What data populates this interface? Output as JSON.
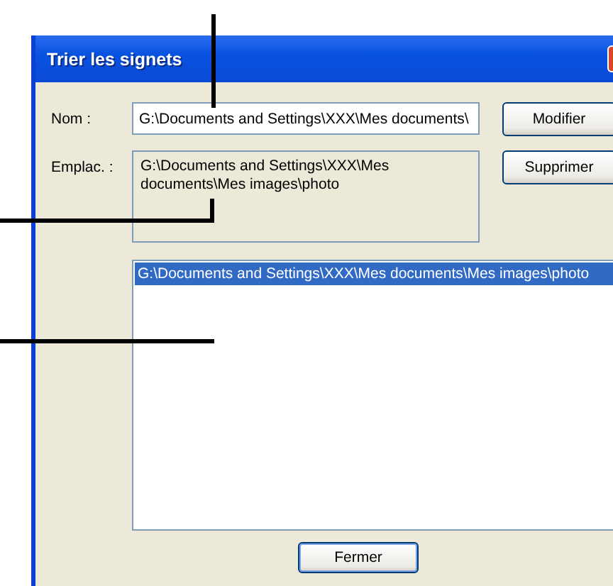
{
  "window": {
    "title": "Trier les signets"
  },
  "name_field": {
    "label": "Nom :",
    "value": "G:\\Documents and Settings\\XXX\\Mes documents\\"
  },
  "location": {
    "label": "Emplac. :",
    "value": "G:\\Documents and Settings\\XXX\\Mes documents\\Mes images\\photo"
  },
  "buttons": [
    {
      "label": "Modifier"
    },
    {
      "label": "Supprimer"
    }
  ],
  "bookmarks": [
    {
      "label": "G:\\Documents and Settings\\XXX\\Mes documents\\Mes images\\photo",
      "selected": true
    }
  ],
  "close_button": {
    "label": "Fermer"
  }
}
